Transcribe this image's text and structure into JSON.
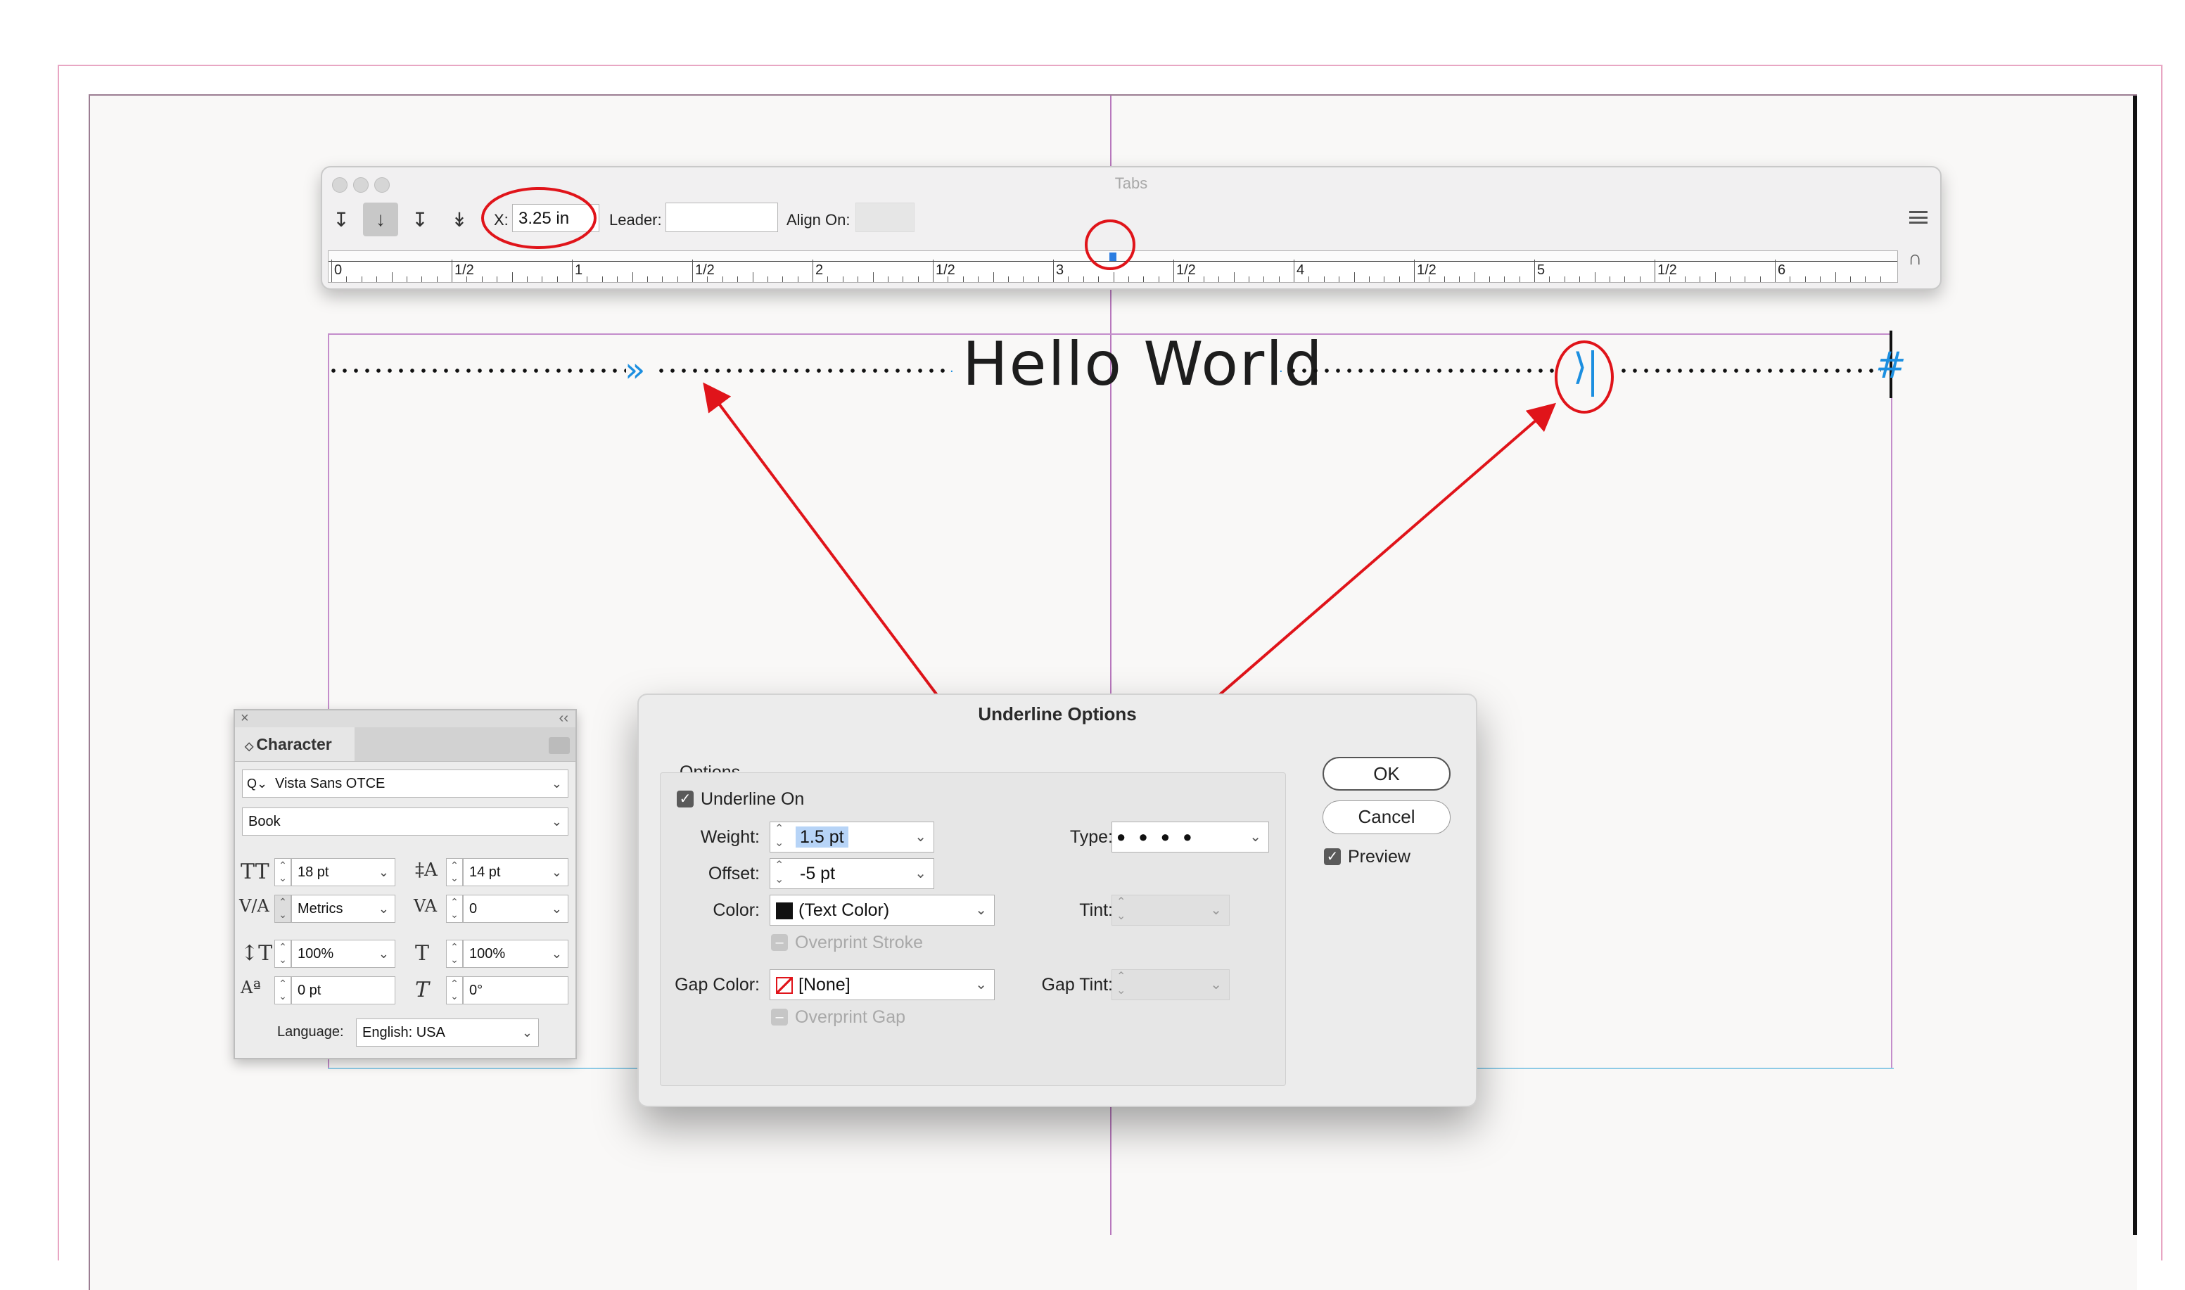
{
  "tabs_panel": {
    "title": "Tabs",
    "x_label": "X:",
    "x_value": "3.25 in",
    "leader_label": "Leader:",
    "leader_value": "",
    "align_on_label": "Align On:",
    "align_on_value": "",
    "tab_buttons": [
      "left-justified-tab-icon",
      "center-justified-tab-icon",
      "right-justified-tab-icon",
      "align-to-decimal-tab-icon"
    ],
    "ruler_labels": [
      "0",
      "1/2",
      "1",
      "1/2",
      "2",
      "1/2",
      "3",
      "1/2",
      "4",
      "1/2",
      "5",
      "1/2",
      "6"
    ]
  },
  "document": {
    "text": "Hello World",
    "tab_glyph": "»",
    "right_indent_glyph": "⟩",
    "end_of_story_glyph": "#"
  },
  "character_panel": {
    "close": "×",
    "collapse": "‹‹",
    "tab_label": "Character",
    "font_family": "Vista Sans OTCE",
    "font_style": "Book",
    "font_size": "18 pt",
    "leading": "14 pt",
    "kerning": "Metrics",
    "tracking": "0",
    "vertical_scale": "100%",
    "horizontal_scale": "100%",
    "baseline_shift": "0 pt",
    "skew": "0°",
    "language_label": "Language:",
    "language": "English: USA"
  },
  "underline_dialog": {
    "title": "Underline Options",
    "group_label": "Options",
    "underline_on_label": "Underline On",
    "underline_on": true,
    "weight_label": "Weight:",
    "weight": "1.5 pt",
    "offset_label": "Offset:",
    "offset": "-5 pt",
    "type_label": "Type:",
    "type_value": "● ● ● ●",
    "color_label": "Color:",
    "color": "(Text Color)",
    "tint_label": "Tint:",
    "overprint_stroke_label": "Overprint Stroke",
    "gap_color_label": "Gap Color:",
    "gap_color": "[None]",
    "gap_tint_label": "Gap Tint:",
    "overprint_gap_label": "Overprint Gap",
    "ok_label": "OK",
    "cancel_label": "Cancel",
    "preview_label": "Preview",
    "preview": true
  },
  "colors": {
    "annotation_red": "#e0141a",
    "tab_blue": "#1c8fe0",
    "guide_purple": "#b878bd"
  }
}
